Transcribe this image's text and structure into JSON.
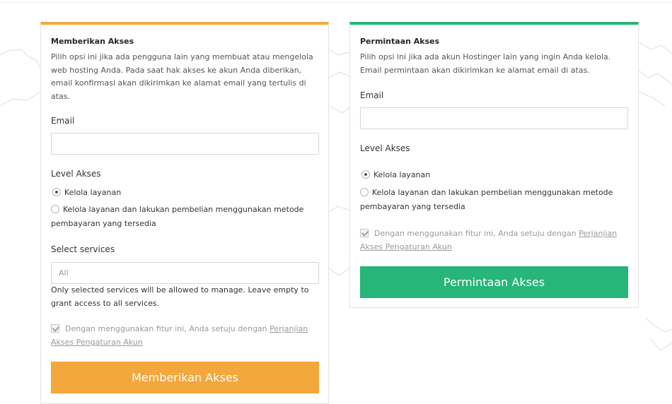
{
  "give_access": {
    "title": "Memberikan Akses",
    "description": "Pilih opsi ini jika ada pengguna lain yang membuat atau mengelola web hosting Anda. Pada saat hak akses ke akun Anda diberikan, email konfirmasi akan dikirimkan ke alamat email yang tertulis di atas.",
    "email_label": "Email",
    "email_value": "",
    "level_label": "Level Akses",
    "options": [
      {
        "label": "Kelola layanan",
        "selected": true
      },
      {
        "label": "Kelola layanan dan lakukan pembelian menggunakan metode pembayaran yang tersedia",
        "selected": false
      }
    ],
    "services_label": "Select services",
    "services_placeholder": "All",
    "services_note": "Only selected services will be allowed to manage. Leave empty to grant access to all services.",
    "agree_text": "Dengan menggunakan fitur ini, Anda setuju dengan",
    "agree_link": "Perjanjian Akses Pengaturan Akun",
    "button_label": "Memberikan Akses",
    "accent_color": "#f4a73b"
  },
  "request_access": {
    "title": "Permintaan Akses",
    "description": "Pilih opsi ini jika ada akun Hostinger lain yang ingin Anda kelola. Email permintaan akan dikirimkan ke alamat email di atas.",
    "email_label": "Email",
    "email_value": "",
    "level_label": "Level Akses",
    "options": [
      {
        "label": "Kelola layanan",
        "selected": true
      },
      {
        "label": "Kelola layanan dan lakukan pembelian menggunakan metode pembayaran yang tersedia",
        "selected": false
      }
    ],
    "agree_text": "Dengan menggunakan fitur ini, Anda setuju dengan",
    "agree_link": "Perjanjian Akses Pengaturan Akun",
    "button_label": "Permintaan Akses",
    "accent_color": "#27b57a"
  }
}
